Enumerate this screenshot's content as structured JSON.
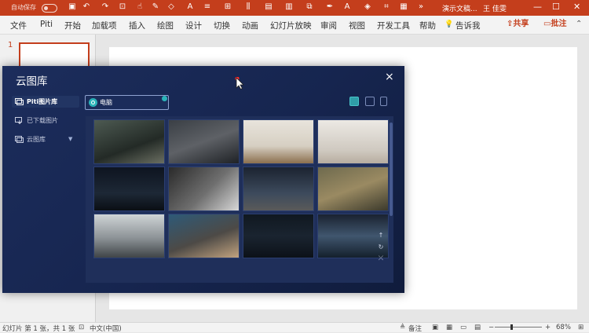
{
  "titlebar": {
    "autosave_label": "自动保存",
    "document_title": "演示文稿...",
    "user_name": "王 佳雯",
    "minimize": "—",
    "maximize": "☐",
    "close": "✕"
  },
  "ribbon": {
    "tabs": [
      "文件",
      "Piti",
      "开始",
      "加载项",
      "插入",
      "绘图",
      "设计",
      "切换",
      "动画",
      "幻灯片放映",
      "审阅",
      "视图",
      "开发工具",
      "帮助"
    ],
    "tell_me": "告诉我",
    "share": "共享",
    "comment": "批注"
  },
  "slides": {
    "current_number": "1"
  },
  "dialog": {
    "title": "云图库",
    "close": "×",
    "nav": [
      {
        "label": "Piti图片库",
        "active": true
      },
      {
        "label": "已下载图片",
        "active": false
      },
      {
        "label": "云图库",
        "active": false,
        "caret": "▼"
      }
    ],
    "search": {
      "value": "电脑"
    },
    "grid": {
      "images": [
        "hands-holding-phone",
        "vr-headset-laptop",
        "imac-desk-plant",
        "keyboard-mouse-white",
        "dark-desk-monitor",
        "laptop-keyboard-overhead",
        "desk-imac-night",
        "hand-laptop-field",
        "office-window-imac",
        "hands-tablet-laptop",
        "code-editor-screen",
        "imac-screen-tiles"
      ]
    },
    "side_controls": [
      "↑",
      "↻",
      "⤫"
    ]
  },
  "statusbar": {
    "slide_info": "幻灯片 第 1 张，共 1 张",
    "language": "中文(中国)",
    "notes": "备注",
    "zoom": "68%"
  },
  "colors": {
    "accent": "#c43e1c",
    "dialog_bg": "#1c2d5c",
    "teal": "#2bb3b9"
  }
}
